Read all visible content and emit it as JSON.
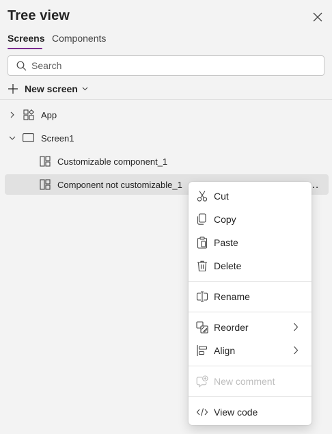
{
  "header": {
    "title": "Tree view"
  },
  "tabs": [
    {
      "label": "Screens",
      "active": true
    },
    {
      "label": "Components",
      "active": false
    }
  ],
  "search": {
    "placeholder": "Search",
    "value": ""
  },
  "toolbar": {
    "new_screen_label": "New screen"
  },
  "tree": {
    "items": [
      {
        "label": "App",
        "icon": "app-icon",
        "expanded": false
      },
      {
        "label": "Screen1",
        "icon": "screen-icon",
        "expanded": true
      },
      {
        "label": "Customizable component_1",
        "icon": "component-icon",
        "selected": false
      },
      {
        "label": "Component not customizable_1",
        "icon": "component-icon",
        "selected": true
      }
    ],
    "more_label": "..."
  },
  "context_menu": {
    "items": [
      {
        "label": "Cut",
        "icon": "scissors-icon"
      },
      {
        "label": "Copy",
        "icon": "copy-icon"
      },
      {
        "label": "Paste",
        "icon": "paste-icon"
      },
      {
        "label": "Delete",
        "icon": "trash-icon"
      },
      {
        "label": "Rename",
        "icon": "rename-icon"
      },
      {
        "label": "Reorder",
        "icon": "reorder-icon",
        "submenu": true
      },
      {
        "label": "Align",
        "icon": "align-icon",
        "submenu": true
      },
      {
        "label": "New comment",
        "icon": "comment-add-icon",
        "disabled": true
      },
      {
        "label": "View code",
        "icon": "code-icon"
      }
    ]
  },
  "colors": {
    "panel_bg": "#f3f3f3",
    "tab_accent": "#7a2a8f",
    "selected_row": "#e1e1e1",
    "menu_bg": "#ffffff",
    "disabled_text": "#bdbdbd"
  }
}
